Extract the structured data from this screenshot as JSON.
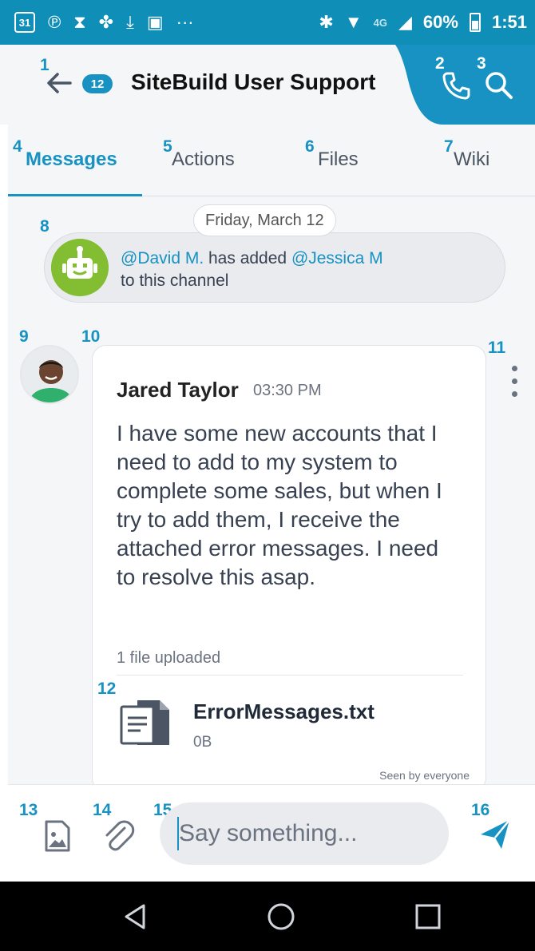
{
  "status_bar": {
    "calendar_day": "31",
    "network": "4G",
    "battery": "60%",
    "time": "1:51"
  },
  "header": {
    "badge_count": "12",
    "title": "SiteBuild User Support"
  },
  "annotations": [
    "1",
    "2",
    "3",
    "4",
    "5",
    "6",
    "7",
    "8",
    "9",
    "10",
    "11",
    "12",
    "13",
    "14",
    "15",
    "16"
  ],
  "tabs": [
    {
      "label": "Messages"
    },
    {
      "label": "Actions"
    },
    {
      "label": "Files"
    },
    {
      "label": "Wiki"
    }
  ],
  "chat": {
    "date": "Friday, March 12",
    "system_message": {
      "mention1": "@David M.",
      "middle": " has added ",
      "mention2": "@Jessica M",
      "end": "to this channel"
    },
    "message": {
      "author": "Jared Taylor",
      "time": "03:30 PM",
      "body": "I have some new accounts that I need to add to my system to complete some sales, but when I try to add them, I receive the attached error messages. I need to resolve this asap.",
      "files_label": "1 file uploaded",
      "file_name": "ErrorMessages.txt",
      "file_size": "0B",
      "seen": "Seen by everyone"
    }
  },
  "compose": {
    "placeholder": "Say something..."
  },
  "colors": {
    "accent": "#1792c2",
    "status_bar": "#0f8fb8",
    "bot": "#82bd32"
  }
}
